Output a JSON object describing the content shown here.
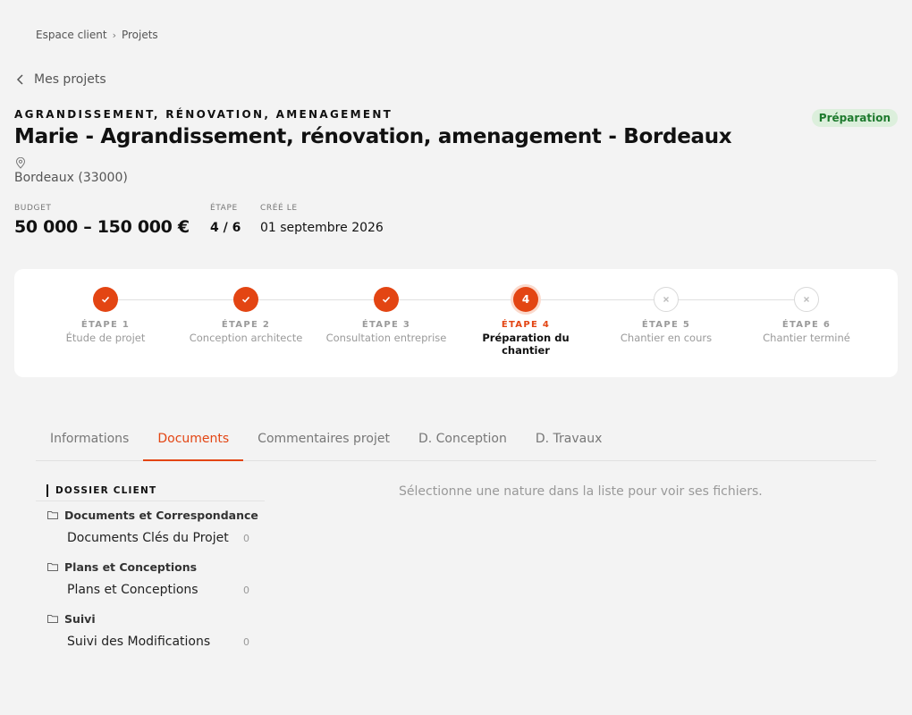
{
  "breadcrumb": {
    "items": [
      "Espace client",
      "Projets"
    ],
    "separator": "›"
  },
  "back_link": {
    "label": "Mes projets"
  },
  "project": {
    "category": "AGRANDISSEMENT, RÉNOVATION, AMENAGEMENT",
    "title": "Marie - Agrandissement, rénovation, amenagement - Bordeaux",
    "status": "Préparation",
    "location": "Bordeaux (33000)",
    "budget_label": "BUDGET",
    "budget_value": "50 000 – 150 000 €",
    "step_label": "ÉTAPE",
    "step_value": "4 / 6",
    "created_label": "CRÉÉ LE",
    "created_value": "01 septembre 2026"
  },
  "stepper": {
    "current": 4,
    "steps": [
      {
        "number": "ÉTAPE 1",
        "name": "Étude de projet",
        "state": "done"
      },
      {
        "number": "ÉTAPE 2",
        "name": "Conception architecte",
        "state": "done"
      },
      {
        "number": "ÉTAPE 3",
        "name": "Consultation entreprise",
        "state": "done"
      },
      {
        "number": "ÉTAPE 4",
        "name": "Préparation du chantier",
        "state": "current",
        "badge": "4"
      },
      {
        "number": "ÉTAPE 5",
        "name": "Chantier en cours",
        "state": "todo"
      },
      {
        "number": "ÉTAPE 6",
        "name": "Chantier terminé",
        "state": "todo"
      }
    ]
  },
  "tabs": [
    {
      "label": "Informations",
      "active": false
    },
    {
      "label": "Documents",
      "active": true
    },
    {
      "label": "Commentaires projet",
      "active": false
    },
    {
      "label": "D. Conception",
      "active": false
    },
    {
      "label": "D. Travaux",
      "active": false
    }
  ],
  "sidebar": {
    "header": "DOSSIER CLIENT",
    "groups": [
      {
        "title": "Documents et Correspondance",
        "items": [
          {
            "label": "Documents Clés du Projet",
            "count": "0"
          }
        ]
      },
      {
        "title": "Plans et Conceptions",
        "items": [
          {
            "label": "Plans et Conceptions",
            "count": "0"
          }
        ]
      },
      {
        "title": "Suivi",
        "items": [
          {
            "label": "Suivi des Modifications",
            "count": "0"
          }
        ]
      }
    ]
  },
  "main": {
    "empty_message": "Sélectionne une nature dans la liste pour voir ses fichiers."
  },
  "colors": {
    "accent": "#e34513",
    "status_bg": "#dcefdc",
    "status_text": "#1e7a2e",
    "page_bg": "#f3f3f3"
  },
  "icons": {
    "back": "chevron-left-icon",
    "location": "map-pin-icon",
    "done_step": "check-icon",
    "todo_step": "x-icon",
    "folder": "folder-icon"
  }
}
